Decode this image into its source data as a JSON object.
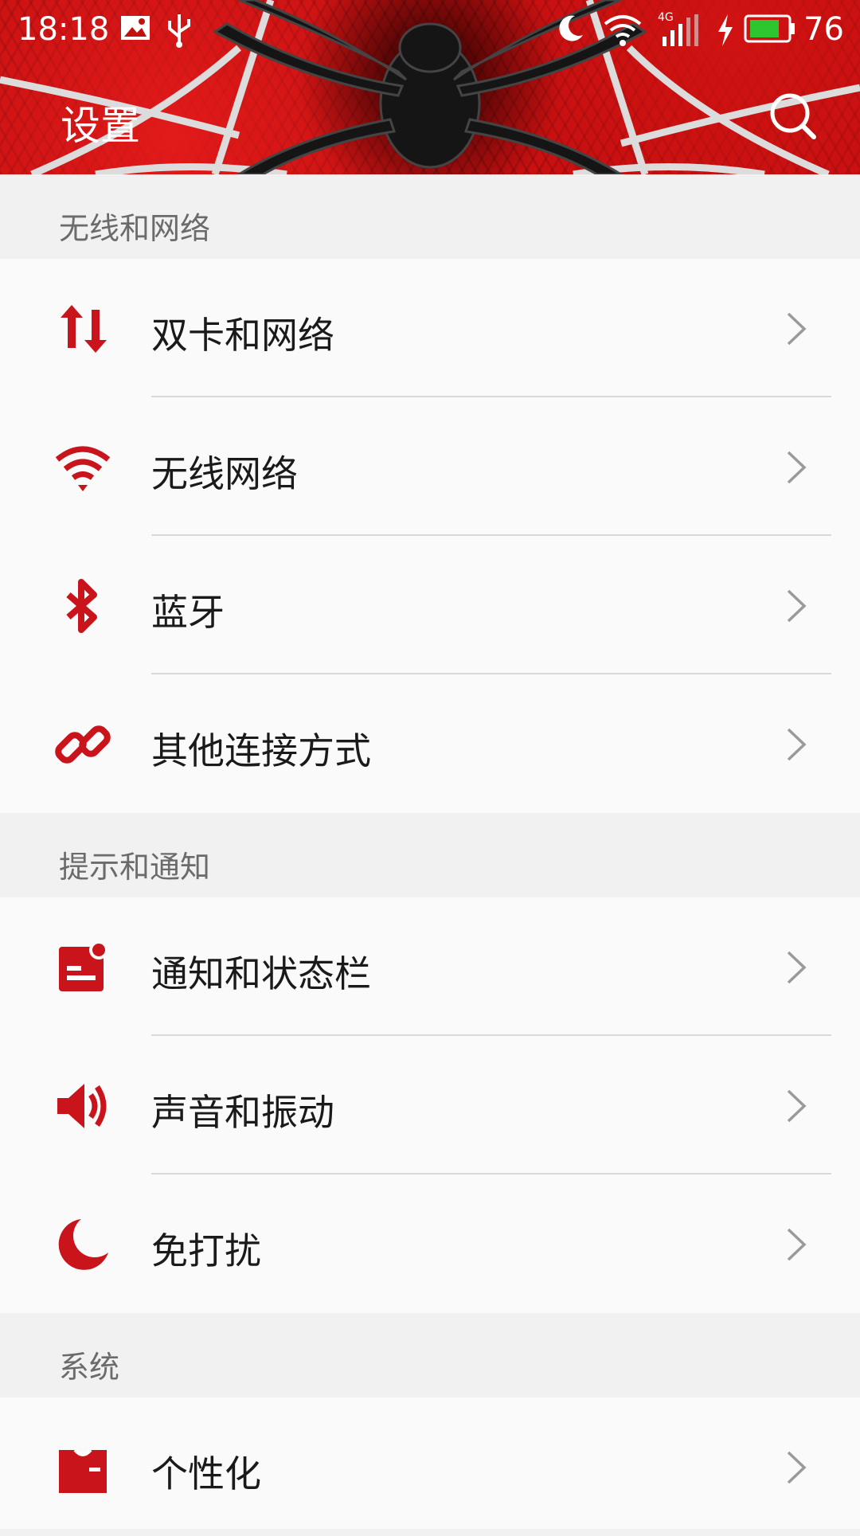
{
  "status_bar": {
    "time": "18:18",
    "network_type": "4G",
    "battery_percent": "76",
    "battery_level": 0.76,
    "icons": [
      "image-icon",
      "usb-icon",
      "moon-icon",
      "wifi-icon",
      "signal-icon",
      "charging-icon",
      "battery-icon"
    ]
  },
  "header": {
    "title": "设置",
    "search_icon": "search-icon"
  },
  "colors": {
    "accent": "#c40f0f",
    "icon_red": "#c8141a",
    "section_bg": "#f1f1f1",
    "row_bg": "#fafafa"
  },
  "sections": [
    {
      "title": "无线和网络",
      "items": [
        {
          "label": "双卡和网络",
          "icon": "dual-sim-data-icon"
        },
        {
          "label": "无线网络",
          "icon": "wifi-icon"
        },
        {
          "label": "蓝牙",
          "icon": "bluetooth-icon"
        },
        {
          "label": "其他连接方式",
          "icon": "link-icon"
        }
      ]
    },
    {
      "title": "提示和通知",
      "items": [
        {
          "label": "通知和状态栏",
          "icon": "notification-icon"
        },
        {
          "label": "声音和振动",
          "icon": "speaker-icon"
        },
        {
          "label": "免打扰",
          "icon": "moon-icon"
        }
      ]
    },
    {
      "title": "系统",
      "items": [
        {
          "label": "个性化",
          "icon": "tshirt-icon"
        }
      ]
    }
  ]
}
